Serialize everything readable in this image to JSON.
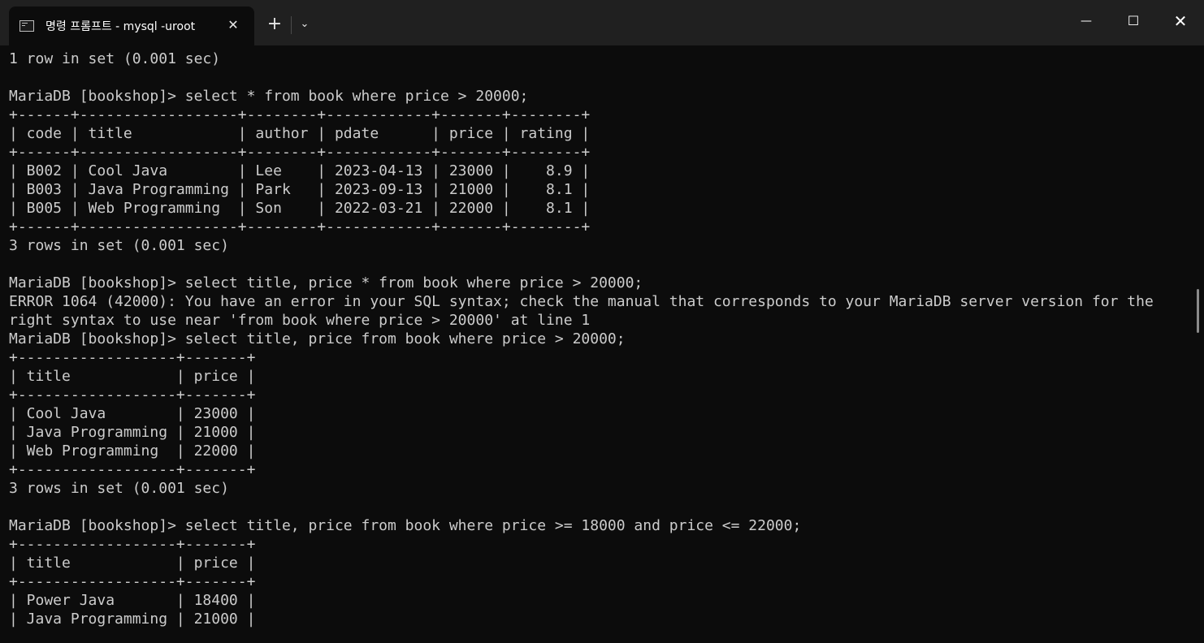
{
  "window": {
    "tab_title": "명령 프롬프트 - mysql  -uroot",
    "tab_close": "✕",
    "new_tab": "+",
    "dropdown": "⌄",
    "minimize": "—",
    "maximize": "☐",
    "close": "✕"
  },
  "terminal": {
    "lines": [
      "1 row in set (0.001 sec)",
      "",
      "MariaDB [bookshop]> select * from book where price > 20000;",
      "+------+------------------+--------+------------+-------+--------+",
      "| code | title            | author | pdate      | price | rating |",
      "+------+------------------+--------+------------+-------+--------+",
      "| B002 | Cool Java        | Lee    | 2023-04-13 | 23000 |    8.9 |",
      "| B003 | Java Programming | Park   | 2023-09-13 | 21000 |    8.1 |",
      "| B005 | Web Programming  | Son    | 2022-03-21 | 22000 |    8.1 |",
      "+------+------------------+--------+------------+-------+--------+",
      "3 rows in set (0.001 sec)",
      "",
      "MariaDB [bookshop]> select title, price * from book where price > 20000;",
      "ERROR 1064 (42000): You have an error in your SQL syntax; check the manual that corresponds to your MariaDB server version for the",
      "right syntax to use near 'from book where price > 20000' at line 1",
      "MariaDB [bookshop]> select title, price from book where price > 20000;",
      "+------------------+-------+",
      "| title            | price |",
      "+------------------+-------+",
      "| Cool Java        | 23000 |",
      "| Java Programming | 21000 |",
      "| Web Programming  | 22000 |",
      "+------------------+-------+",
      "3 rows in set (0.001 sec)",
      "",
      "MariaDB [bookshop]> select title, price from book where price >= 18000 and price <= 22000;",
      "+------------------+-------+",
      "| title            | price |",
      "+------------------+-------+",
      "| Power Java       | 18400 |",
      "| Java Programming | 21000 |"
    ]
  }
}
